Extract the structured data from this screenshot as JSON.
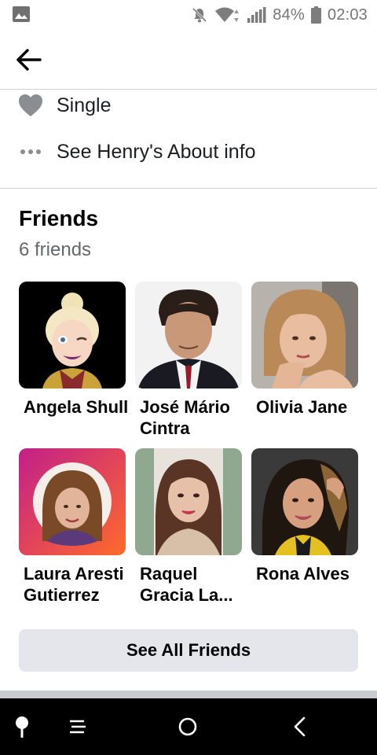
{
  "status_bar": {
    "battery_percent": "84%",
    "time": "02:03",
    "icons": [
      "gallery-icon",
      "mute-icon",
      "wifi-icon",
      "signal-icon",
      "battery-icon"
    ]
  },
  "app_bar": {
    "back_icon": "arrow-left-icon"
  },
  "about": {
    "relationship": {
      "icon": "heart-icon",
      "label": "Single"
    },
    "see_about": {
      "icon": "more-dots-icon",
      "label": "See Henry's About info"
    }
  },
  "friends": {
    "title": "Friends",
    "count": "6 friends",
    "list": [
      {
        "name": "Angela Shull",
        "avatar_bg": "#000000"
      },
      {
        "name": "José Mário Cintra",
        "avatar_bg": "#f2f2f2"
      },
      {
        "name": "Olivia Jane",
        "avatar_bg": "#d9d3cf"
      },
      {
        "name": "Laura Aresti Gutierrez",
        "avatar_bg": "#d02a7a"
      },
      {
        "name": "Raquel Gracia La...",
        "avatar_bg": "#8fa88f"
      },
      {
        "name": "Rona Alves",
        "avatar_bg": "#3a3a3a"
      }
    ],
    "see_all_label": "See All Friends"
  },
  "nav_bar": {
    "icons": [
      "pin-icon",
      "menu-icon",
      "home-circle-icon",
      "back-chevron-icon"
    ]
  },
  "colors": {
    "divider": "#cfd0d3",
    "button_bg": "#e4e6eb",
    "secondary_text": "#65676b"
  }
}
